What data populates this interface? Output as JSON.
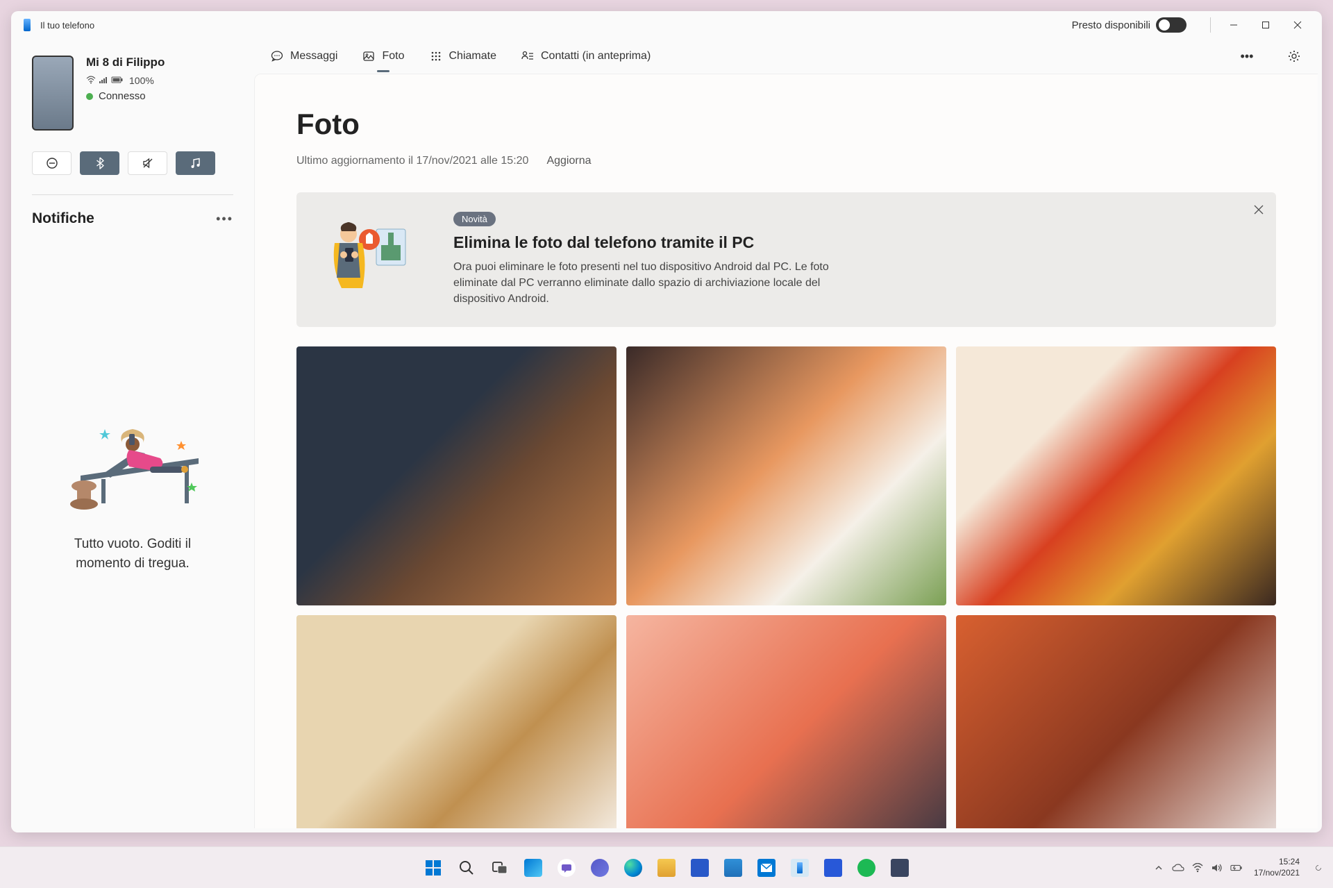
{
  "titlebar": {
    "app_name": "Il tuo telefono",
    "toggle_label": "Presto disponibili"
  },
  "device": {
    "name": "Mi 8 di Filippo",
    "battery": "100%",
    "connection": "Connesso"
  },
  "notifications": {
    "header": "Notifiche",
    "empty_text_line1": "Tutto vuoto. Goditi il",
    "empty_text_line2": "momento di tregua."
  },
  "tabs": {
    "messages": "Messaggi",
    "photos": "Foto",
    "calls": "Chiamate",
    "contacts": "Contatti (in anteprima)"
  },
  "content": {
    "title": "Foto",
    "subtitle": "Ultimo aggiornamento il 17/nov/2021 alle 15:20",
    "refresh": "Aggiorna"
  },
  "info_card": {
    "badge": "Novità",
    "title": "Elimina le foto dal telefono tramite il PC",
    "text": "Ora puoi eliminare le foto presenti nel tuo dispositivo Android dal PC. Le foto eliminate dal PC verranno eliminate dallo spazio di archiviazione locale del dispositivo Android."
  },
  "taskbar": {
    "time": "15:24",
    "date": "17/nov/2021"
  }
}
